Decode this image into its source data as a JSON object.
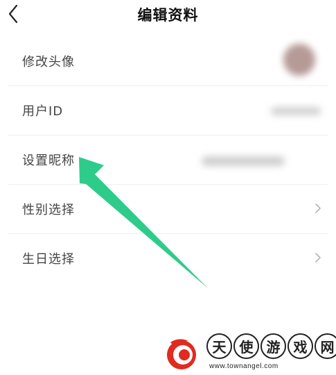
{
  "header": {
    "title": "编辑资料",
    "back_icon": "chevron-left-icon"
  },
  "rows": [
    {
      "label": "修改头像"
    },
    {
      "label": "用户ID"
    },
    {
      "label": "设置昵称"
    },
    {
      "label": "性别选择"
    },
    {
      "label": "生日选择"
    }
  ],
  "annotation": {
    "arrow_color": "#2ecc8a"
  },
  "watermark": {
    "chars": [
      "天",
      "使",
      "游",
      "戏",
      "网"
    ],
    "url": "www.townangel.com",
    "logo_color": "#e02b20"
  }
}
